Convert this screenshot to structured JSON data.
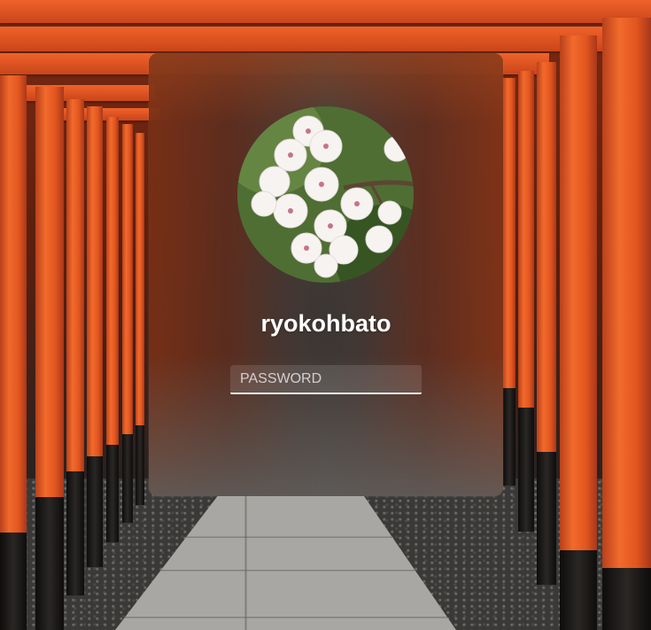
{
  "login": {
    "username": "ryokohbato",
    "password": {
      "value": "",
      "placeholder": "PASSWORD"
    }
  },
  "icons": {
    "avatar": "cherry-blossom-photo"
  },
  "colors": {
    "torii_orange": "#f26a2c",
    "text": "#ffffff"
  }
}
